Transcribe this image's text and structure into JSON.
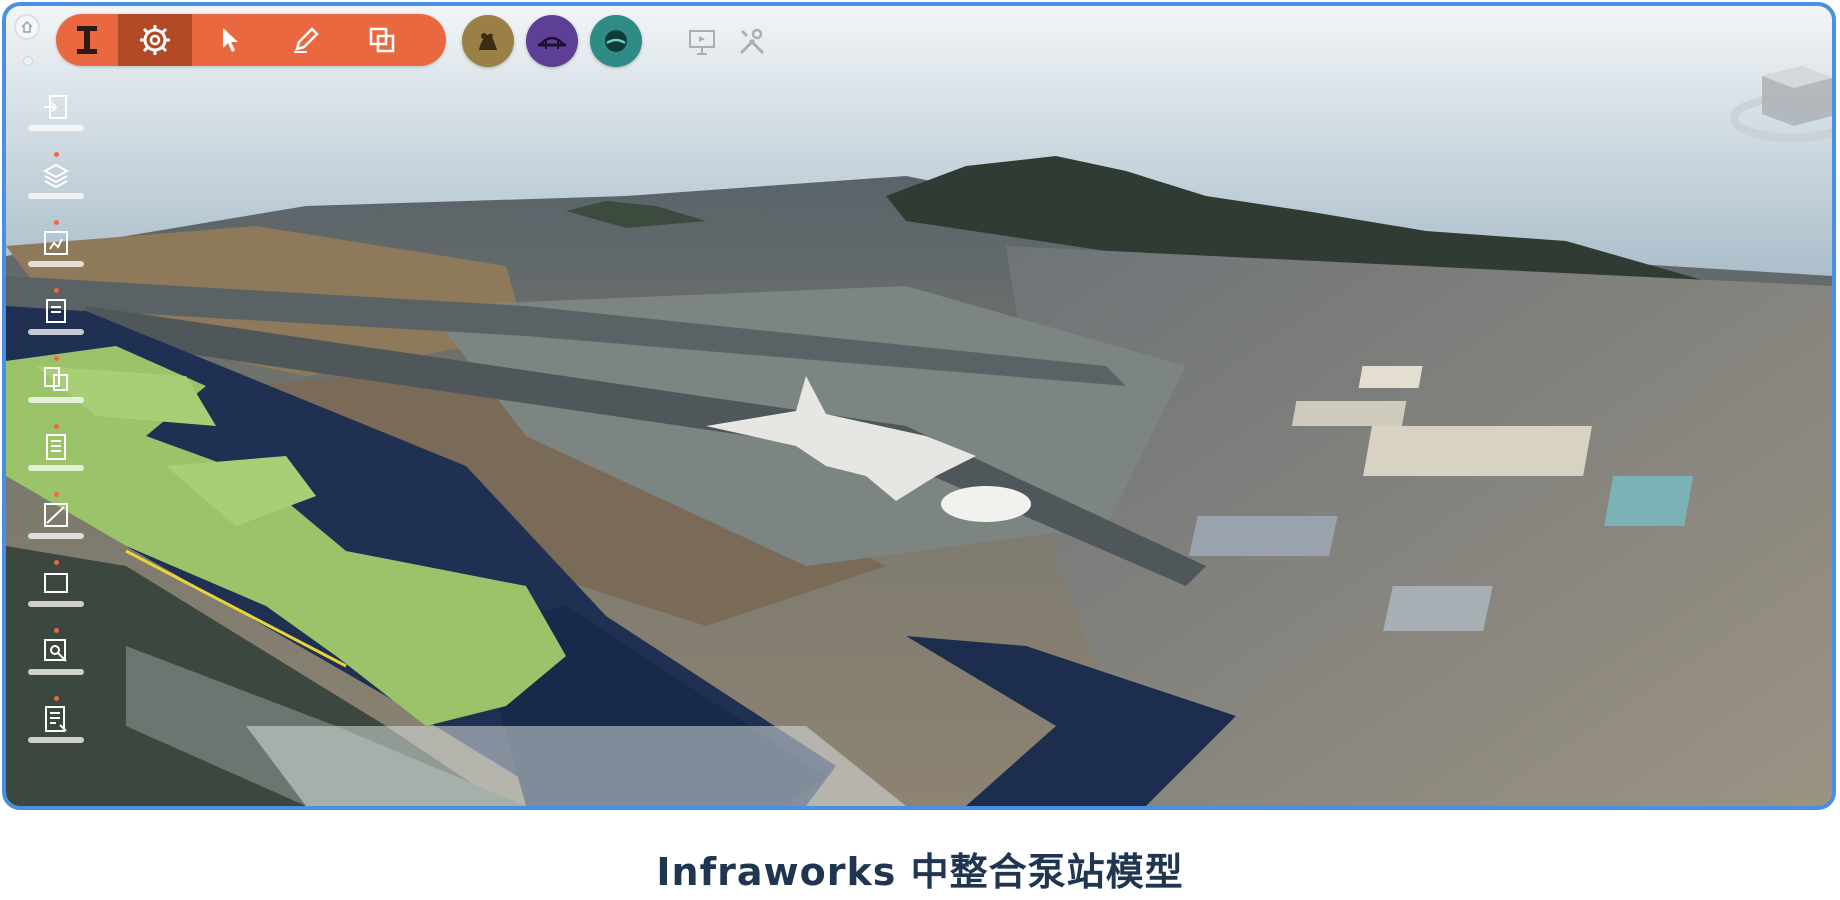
{
  "caption": "Infraworks 中整合泵站模型",
  "colors": {
    "frame_border": "#4a90e2",
    "toolbar": "#e9683f",
    "toolbar_active": "#b34a27",
    "caption": "#1f3550",
    "sidebar_dot": "#ec6b3b"
  },
  "toolbar": {
    "tools": [
      {
        "id": "model",
        "icon": "i-beam-icon",
        "active": false
      },
      {
        "id": "settings",
        "icon": "gear-icon",
        "active": true
      },
      {
        "id": "select",
        "icon": "cursor-icon",
        "active": false
      },
      {
        "id": "sketch",
        "icon": "pen-icon",
        "active": false
      },
      {
        "id": "copy",
        "icon": "copy-icon",
        "active": false
      }
    ]
  },
  "circle_buttons": [
    {
      "id": "terrain",
      "icon": "terrain-icon",
      "color": "#9a8044"
    },
    {
      "id": "bridge",
      "icon": "bridge-icon",
      "color": "#5d3f95"
    },
    {
      "id": "drainage",
      "icon": "drainage-icon",
      "color": "#2e8b86"
    }
  ],
  "utility_buttons": [
    {
      "id": "present",
      "icon": "presentation-icon"
    },
    {
      "id": "tools",
      "icon": "tools-icon"
    }
  ],
  "sidebar": {
    "items": [
      {
        "id": "import",
        "icon": "import-icon"
      },
      {
        "id": "layers",
        "icon": "layers-icon"
      },
      {
        "id": "style",
        "icon": "style-icon"
      },
      {
        "id": "document",
        "icon": "document-icon"
      },
      {
        "id": "analysis",
        "icon": "analysis-icon"
      },
      {
        "id": "list",
        "icon": "list-icon"
      },
      {
        "id": "profile",
        "icon": "profile-icon"
      },
      {
        "id": "window",
        "icon": "window-icon"
      },
      {
        "id": "inspect",
        "icon": "inspect-icon"
      },
      {
        "id": "report",
        "icon": "report-icon"
      }
    ]
  }
}
